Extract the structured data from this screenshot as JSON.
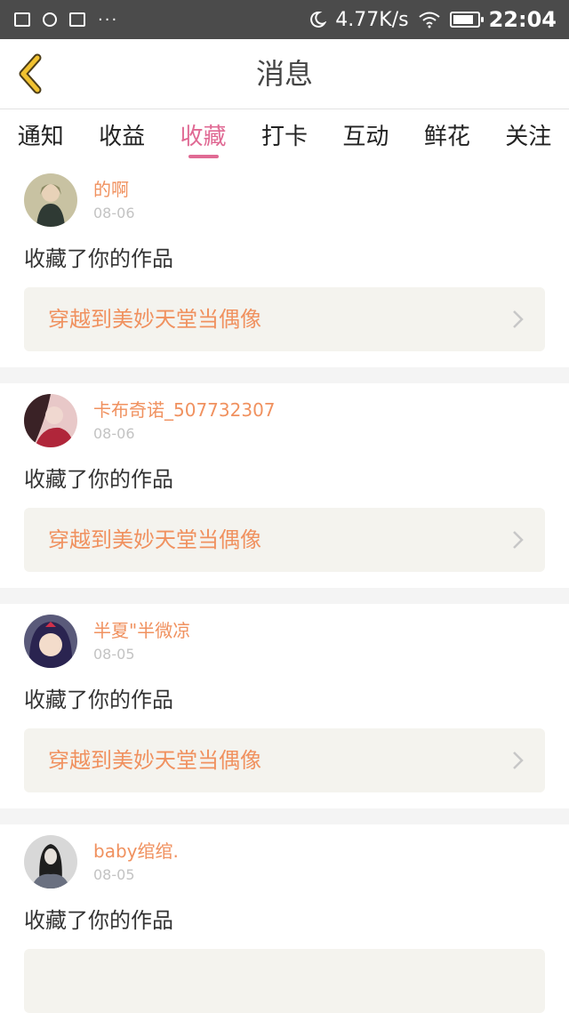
{
  "status_bar": {
    "icons": [
      "image-icon",
      "chat-bubble-icon",
      "screenshot-icon",
      "more-dots-icon"
    ],
    "dots": "···",
    "speed": "4.77K/s",
    "time": "22:04",
    "right_icons": [
      "moon-icon",
      "wifi-icon",
      "battery-icon"
    ]
  },
  "header": {
    "title": "消息"
  },
  "tabs": [
    {
      "label": "通知"
    },
    {
      "label": "收益"
    },
    {
      "label": "收藏"
    },
    {
      "label": "打卡"
    },
    {
      "label": "互动"
    },
    {
      "label": "鲜花"
    },
    {
      "label": "关注"
    }
  ],
  "active_tab": 2,
  "items": [
    {
      "name": "的啊",
      "date": "08-06",
      "action": "收藏了你的作品",
      "work": "穿越到美妙天堂当偶像"
    },
    {
      "name": "卡布奇诺_507732307",
      "date": "08-06",
      "action": "收藏了你的作品",
      "work": "穿越到美妙天堂当偶像"
    },
    {
      "name": "半夏\"半微凉",
      "date": "08-05",
      "action": "收藏了你的作品",
      "work": "穿越到美妙天堂当偶像"
    },
    {
      "name": "baby绾绾.",
      "date": "08-05",
      "action": "收藏了你的作品",
      "work": ""
    }
  ],
  "colors": {
    "accent": "#e06a94",
    "name": "#f0915f",
    "status_bar": "#4b4b4b",
    "card_bg": "#f4f3ee",
    "divider": "#f4f4f4"
  }
}
